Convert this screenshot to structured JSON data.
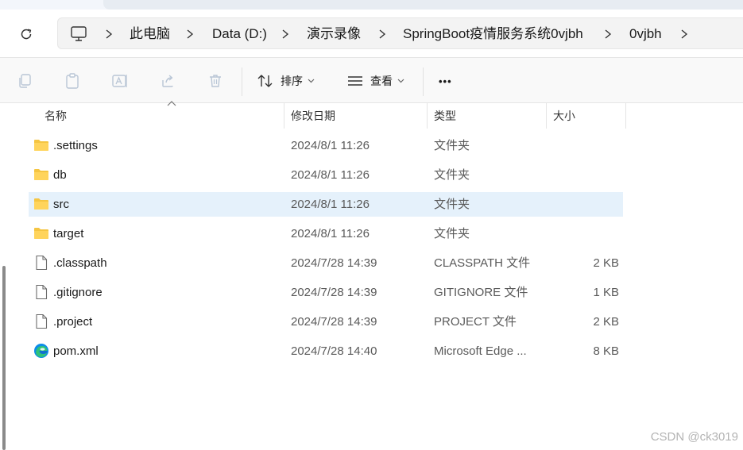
{
  "window": {
    "breadcrumb": [
      "此电脑",
      "Data (D:)",
      "演示录像",
      "SpringBoot疫情服务系统0vjbh",
      "0vjbh"
    ]
  },
  "toolbar": {
    "sort_label": "排序",
    "view_label": "查看",
    "more_label": "•••"
  },
  "columns": {
    "name": "名称",
    "modified": "修改日期",
    "type": "类型",
    "size": "大小"
  },
  "files": [
    {
      "name": ".settings",
      "modified": "2024/8/1 11:26",
      "type": "文件夹",
      "size": "",
      "icon": "folder-icon",
      "selected": false
    },
    {
      "name": "db",
      "modified": "2024/8/1 11:26",
      "type": "文件夹",
      "size": "",
      "icon": "folder-icon",
      "selected": false
    },
    {
      "name": "src",
      "modified": "2024/8/1 11:26",
      "type": "文件夹",
      "size": "",
      "icon": "folder-icon",
      "selected": true
    },
    {
      "name": "target",
      "modified": "2024/8/1 11:26",
      "type": "文件夹",
      "size": "",
      "icon": "folder-icon",
      "selected": false
    },
    {
      "name": ".classpath",
      "modified": "2024/7/28 14:39",
      "type": "CLASSPATH 文件",
      "size": "2 KB",
      "icon": "file-icon",
      "selected": false
    },
    {
      "name": ".gitignore",
      "modified": "2024/7/28 14:39",
      "type": "GITIGNORE 文件",
      "size": "1 KB",
      "icon": "file-icon",
      "selected": false
    },
    {
      "name": ".project",
      "modified": "2024/7/28 14:39",
      "type": "PROJECT 文件",
      "size": "2 KB",
      "icon": "file-icon",
      "selected": false
    },
    {
      "name": "pom.xml",
      "modified": "2024/7/28 14:40",
      "type": "Microsoft Edge ...",
      "size": "8 KB",
      "icon": "edge-icon",
      "selected": false
    }
  ],
  "watermark": "CSDN @ck3019",
  "colors": {
    "selection": "#e5f1fb",
    "folder": "#f5c542",
    "toolbar_bg": "#f9f9f9"
  }
}
